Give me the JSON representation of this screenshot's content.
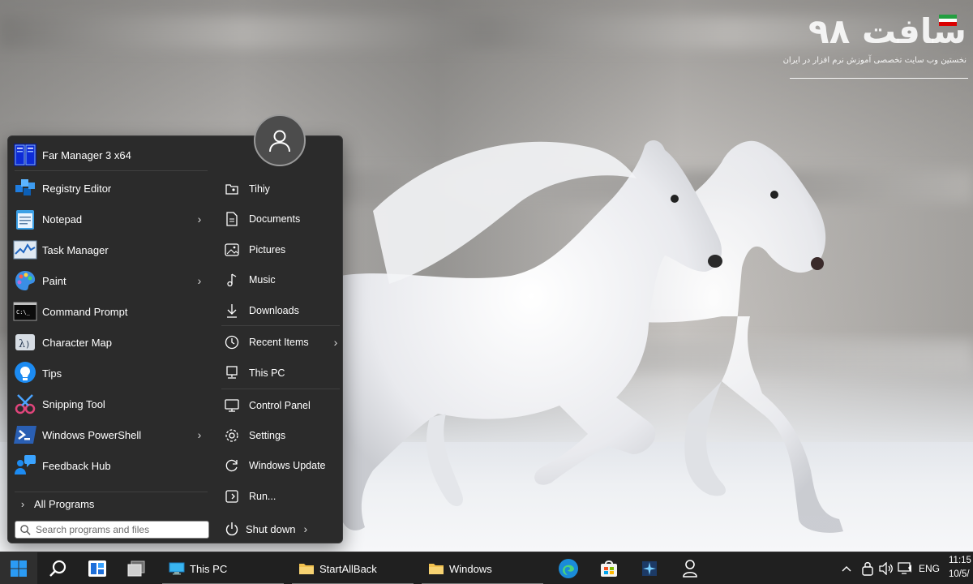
{
  "watermark": {
    "title": "سافت ۹۸",
    "subtitle": "نخستین وب سایت تخصصی آموزش نرم افزار در ایران"
  },
  "start_menu": {
    "pinned": [
      {
        "label": "Far Manager 3 x64",
        "icon": "far-manager-icon",
        "submenu": false
      },
      {
        "label": "Registry Editor",
        "icon": "registry-editor-icon",
        "submenu": false
      },
      {
        "label": "Notepad",
        "icon": "notepad-icon",
        "submenu": true
      },
      {
        "label": "Task Manager",
        "icon": "task-manager-icon",
        "submenu": false
      },
      {
        "label": "Paint",
        "icon": "paint-icon",
        "submenu": true
      },
      {
        "label": "Command Prompt",
        "icon": "command-prompt-icon",
        "submenu": false
      },
      {
        "label": "Character Map",
        "icon": "character-map-icon",
        "submenu": false
      },
      {
        "label": "Tips",
        "icon": "tips-icon",
        "submenu": false
      },
      {
        "label": "Snipping Tool",
        "icon": "snipping-tool-icon",
        "submenu": false
      },
      {
        "label": "Windows PowerShell",
        "icon": "powershell-icon",
        "submenu": true
      },
      {
        "label": "Feedback Hub",
        "icon": "feedback-hub-icon",
        "submenu": false
      }
    ],
    "all_programs": "All Programs",
    "search_placeholder": "Search programs and files",
    "places": [
      {
        "label": "Tihiy",
        "icon": "user-folder-icon",
        "submenu": false
      },
      {
        "label": "Documents",
        "icon": "documents-icon",
        "submenu": false
      },
      {
        "label": "Pictures",
        "icon": "pictures-icon",
        "submenu": false
      },
      {
        "label": "Music",
        "icon": "music-icon",
        "submenu": false
      },
      {
        "label": "Downloads",
        "icon": "downloads-icon",
        "submenu": false
      },
      {
        "label": "Recent Items",
        "icon": "clock-icon",
        "submenu": true
      },
      {
        "label": "This PC",
        "icon": "this-pc-icon",
        "submenu": false
      },
      {
        "label": "Control Panel",
        "icon": "control-panel-icon",
        "submenu": false
      },
      {
        "label": "Settings",
        "icon": "gear-icon",
        "submenu": false
      },
      {
        "label": "Windows Update",
        "icon": "windows-update-icon",
        "submenu": false
      },
      {
        "label": "Run...",
        "icon": "run-icon",
        "submenu": false
      }
    ],
    "shutdown": "Shut down"
  },
  "taskbar": {
    "windows": [
      {
        "label": "This PC",
        "icon": "this-pc-icon"
      },
      {
        "label": "StartAllBack",
        "icon": "folder-icon"
      },
      {
        "label": "Windows",
        "icon": "folder-icon"
      }
    ],
    "language": "ENG",
    "time": "11:15",
    "date": "10/5/"
  },
  "colors": {
    "menu_bg": "#2b2b2b",
    "taskbar_bg": "#202020",
    "accent_blue": "#1e88e5",
    "folder_yellow": "#f2c14e"
  }
}
